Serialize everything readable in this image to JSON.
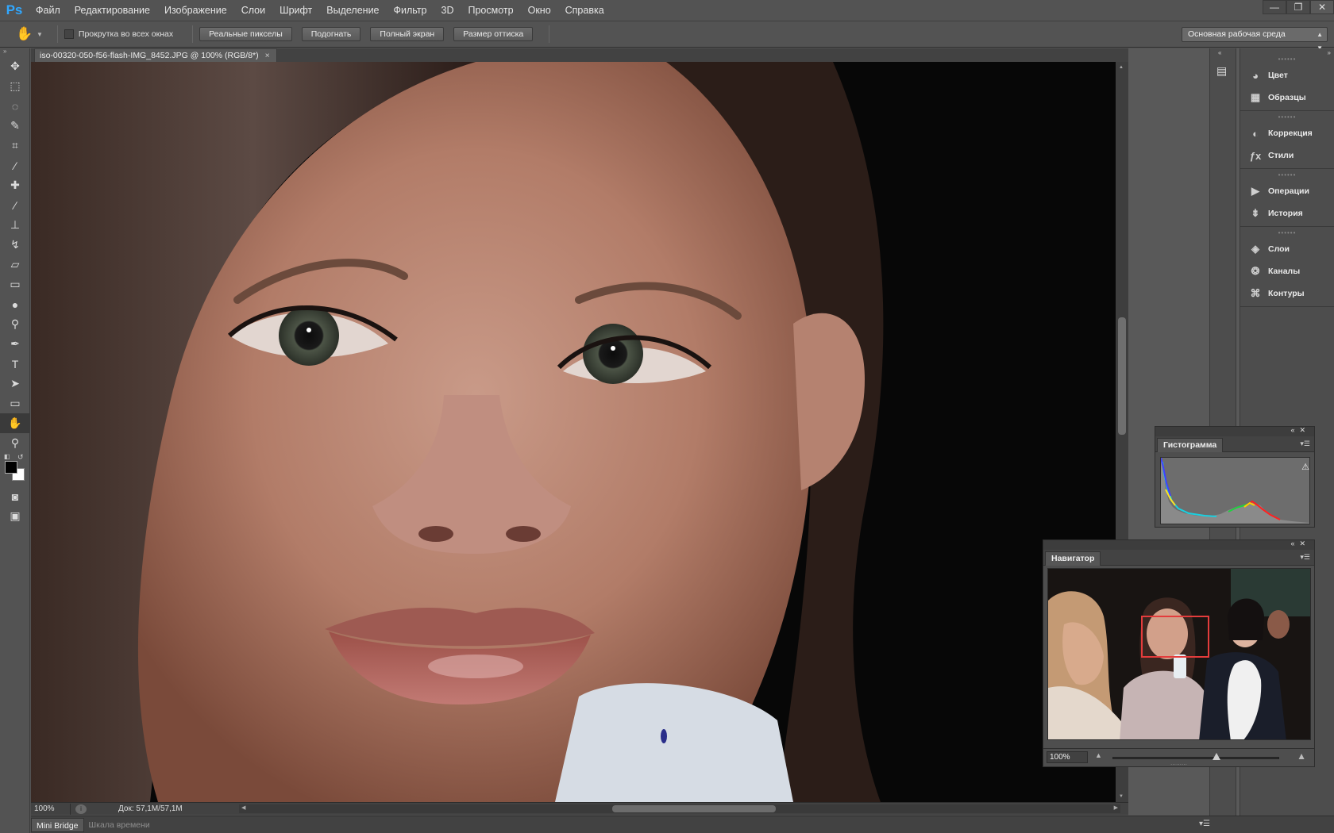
{
  "app": {
    "logo": "Ps",
    "accent": "#31a8ff",
    "menu": [
      "Файл",
      "Редактирование",
      "Изображение",
      "Слои",
      "Шрифт",
      "Выделение",
      "Фильтр",
      "3D",
      "Просмотр",
      "Окно",
      "Справка"
    ],
    "window_controls": [
      "—",
      "❐",
      "✕"
    ]
  },
  "options_bar": {
    "tool_icon": "hand-icon",
    "scroll_all_label": "Прокрутка во всех окнах",
    "scroll_all_checked": false,
    "buttons": [
      "Реальные пикселы",
      "Подогнать",
      "Полный экран",
      "Размер оттиска"
    ],
    "workspace": "Основная рабочая среда"
  },
  "tools": [
    {
      "name": "move-tool",
      "icon": "move-icon",
      "glyph": "✥"
    },
    {
      "name": "marquee-tool",
      "icon": "marquee-icon",
      "glyph": "⬚"
    },
    {
      "name": "lasso-tool",
      "icon": "lasso-icon",
      "glyph": "◌"
    },
    {
      "name": "quick-select-tool",
      "icon": "quick-select-icon",
      "glyph": "✎"
    },
    {
      "name": "crop-tool",
      "icon": "crop-icon",
      "glyph": "⌗"
    },
    {
      "name": "eyedropper-tool",
      "icon": "eyedropper-icon",
      "glyph": "⁄"
    },
    {
      "name": "healing-tool",
      "icon": "bandage-icon",
      "glyph": "✚"
    },
    {
      "name": "brush-tool",
      "icon": "brush-icon",
      "glyph": "∕"
    },
    {
      "name": "stamp-tool",
      "icon": "stamp-icon",
      "glyph": "⊥"
    },
    {
      "name": "history-brush-tool",
      "icon": "history-brush-icon",
      "glyph": "↯"
    },
    {
      "name": "eraser-tool",
      "icon": "eraser-icon",
      "glyph": "▱"
    },
    {
      "name": "gradient-tool",
      "icon": "gradient-icon",
      "glyph": "▭"
    },
    {
      "name": "blur-tool",
      "icon": "drop-icon",
      "glyph": "●"
    },
    {
      "name": "dodge-tool",
      "icon": "dodge-icon",
      "glyph": "⚲"
    },
    {
      "name": "pen-tool",
      "icon": "pen-icon",
      "glyph": "✒"
    },
    {
      "name": "type-tool",
      "icon": "type-icon",
      "glyph": "T"
    },
    {
      "name": "path-select-tool",
      "icon": "arrow-icon",
      "glyph": "➤"
    },
    {
      "name": "shape-tool",
      "icon": "rectangle-icon",
      "glyph": "▭"
    },
    {
      "name": "hand-tool",
      "icon": "hand-icon",
      "glyph": "✋",
      "active": true
    },
    {
      "name": "zoom-tool",
      "icon": "zoom-icon",
      "glyph": "⚲"
    }
  ],
  "colors": {
    "foreground": "#000000",
    "background": "#ffffff"
  },
  "extra_tools": [
    {
      "name": "quick-mask-tool",
      "icon": "quick-mask-icon",
      "glyph": "◙"
    },
    {
      "name": "screen-mode-tool",
      "icon": "screen-mode-icon",
      "glyph": "▣"
    }
  ],
  "document": {
    "tab_title": "iso-00320-050-f56-flash-IMG_8452.JPG @ 100% (RGB/8*)",
    "close": "×"
  },
  "status": {
    "zoom": "100%",
    "doc_size": "Док: 57,1M/57,1M"
  },
  "bottom_tabs": [
    {
      "label": "Mini Bridge",
      "active": true
    },
    {
      "label": "Шкала времени",
      "active": false
    }
  ],
  "dock": {
    "groups": [
      [
        {
          "label": "Цвет",
          "icon": "palette-icon",
          "glyph": "◕"
        },
        {
          "label": "Образцы",
          "icon": "swatches-icon",
          "glyph": "▦"
        }
      ],
      [
        {
          "label": "Коррекция",
          "icon": "adjustment-icon",
          "glyph": "◐"
        },
        {
          "label": "Стили",
          "icon": "fx-icon",
          "glyph": "ƒx"
        }
      ],
      [
        {
          "label": "Операции",
          "icon": "play-icon",
          "glyph": "▶"
        },
        {
          "label": "История",
          "icon": "history-icon",
          "glyph": "⇟"
        }
      ],
      [
        {
          "label": "Слои",
          "icon": "layers-icon",
          "glyph": "◈"
        },
        {
          "label": "Каналы",
          "icon": "channels-icon",
          "glyph": "❂"
        },
        {
          "label": "Контуры",
          "icon": "paths-icon",
          "glyph": "⌘"
        }
      ]
    ]
  },
  "histogram": {
    "title": "Гистограмма"
  },
  "navigator": {
    "title": "Навигатор",
    "zoom": "100%",
    "zoom_level": 0.62
  }
}
